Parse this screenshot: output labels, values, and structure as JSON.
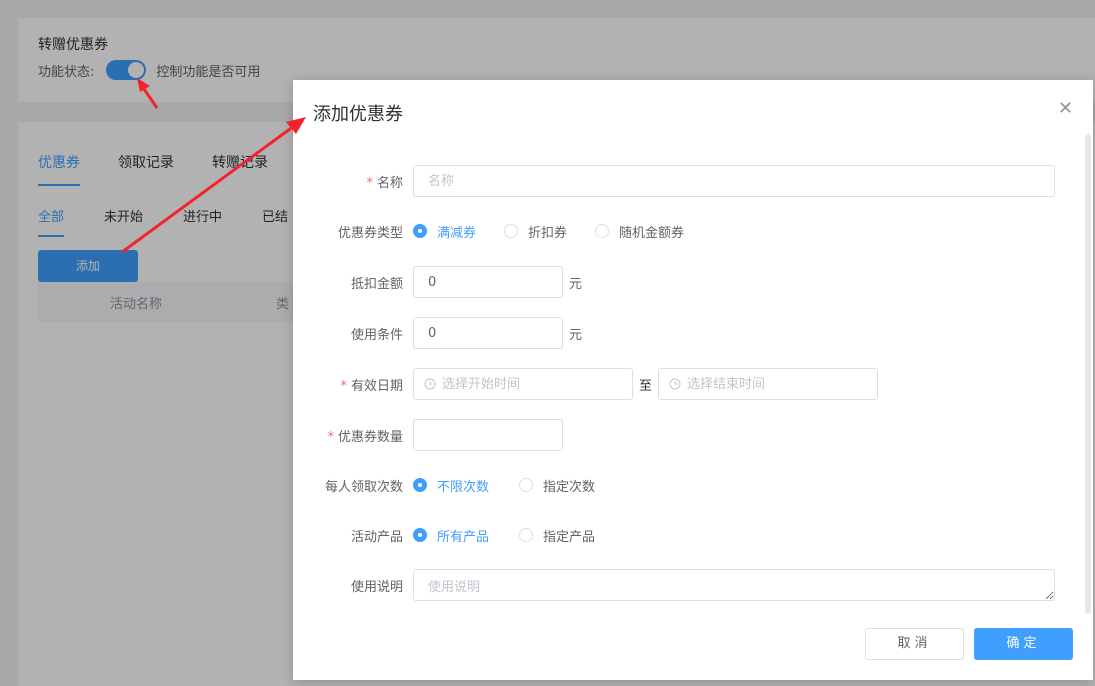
{
  "background": {
    "card_title": "转赠优惠券",
    "status_label": "功能状态:",
    "status_hint": "控制功能是否可用",
    "tabs": [
      {
        "label": "优惠券",
        "active": true
      },
      {
        "label": "领取记录",
        "active": false
      },
      {
        "label": "转赠记录",
        "active": false
      }
    ],
    "subtabs": [
      {
        "label": "全部",
        "active": true
      },
      {
        "label": "未开始",
        "active": false
      },
      {
        "label": "进行中",
        "active": false
      },
      {
        "label": "已结",
        "active": false
      }
    ],
    "add_button": "添加",
    "table_headers": [
      "活动名称",
      "类"
    ]
  },
  "dialog": {
    "title": "添加优惠券",
    "close_icon": "close-icon",
    "fields": {
      "name": {
        "label": "名称",
        "required": true,
        "placeholder": "名称",
        "value": ""
      },
      "coupon_type": {
        "label": "优惠券类型",
        "options": [
          "满减券",
          "折扣券",
          "随机金额券"
        ],
        "selected": "满减券"
      },
      "discount_amount": {
        "label": "抵扣金额",
        "value": "0",
        "unit": "元"
      },
      "usage_condition": {
        "label": "使用条件",
        "value": "0",
        "unit": "元"
      },
      "valid_date": {
        "label": "有效日期",
        "required": true,
        "start_placeholder": "选择开始时间",
        "separator": "至",
        "end_placeholder": "选择结束时间"
      },
      "quantity": {
        "label": "优惠券数量",
        "required": true,
        "value": ""
      },
      "per_person": {
        "label": "每人领取次数",
        "options": [
          "不限次数",
          "指定次数"
        ],
        "selected": "不限次数"
      },
      "products": {
        "label": "活动产品",
        "options": [
          "所有产品",
          "指定产品"
        ],
        "selected": "所有产品"
      },
      "description": {
        "label": "使用说明",
        "placeholder": "使用说明"
      }
    },
    "cancel_label": "取消",
    "ok_label": "确定"
  },
  "colors": {
    "primary": "#409eff",
    "required": "#f56c6c",
    "annotation_arrow": "#f5222d"
  }
}
